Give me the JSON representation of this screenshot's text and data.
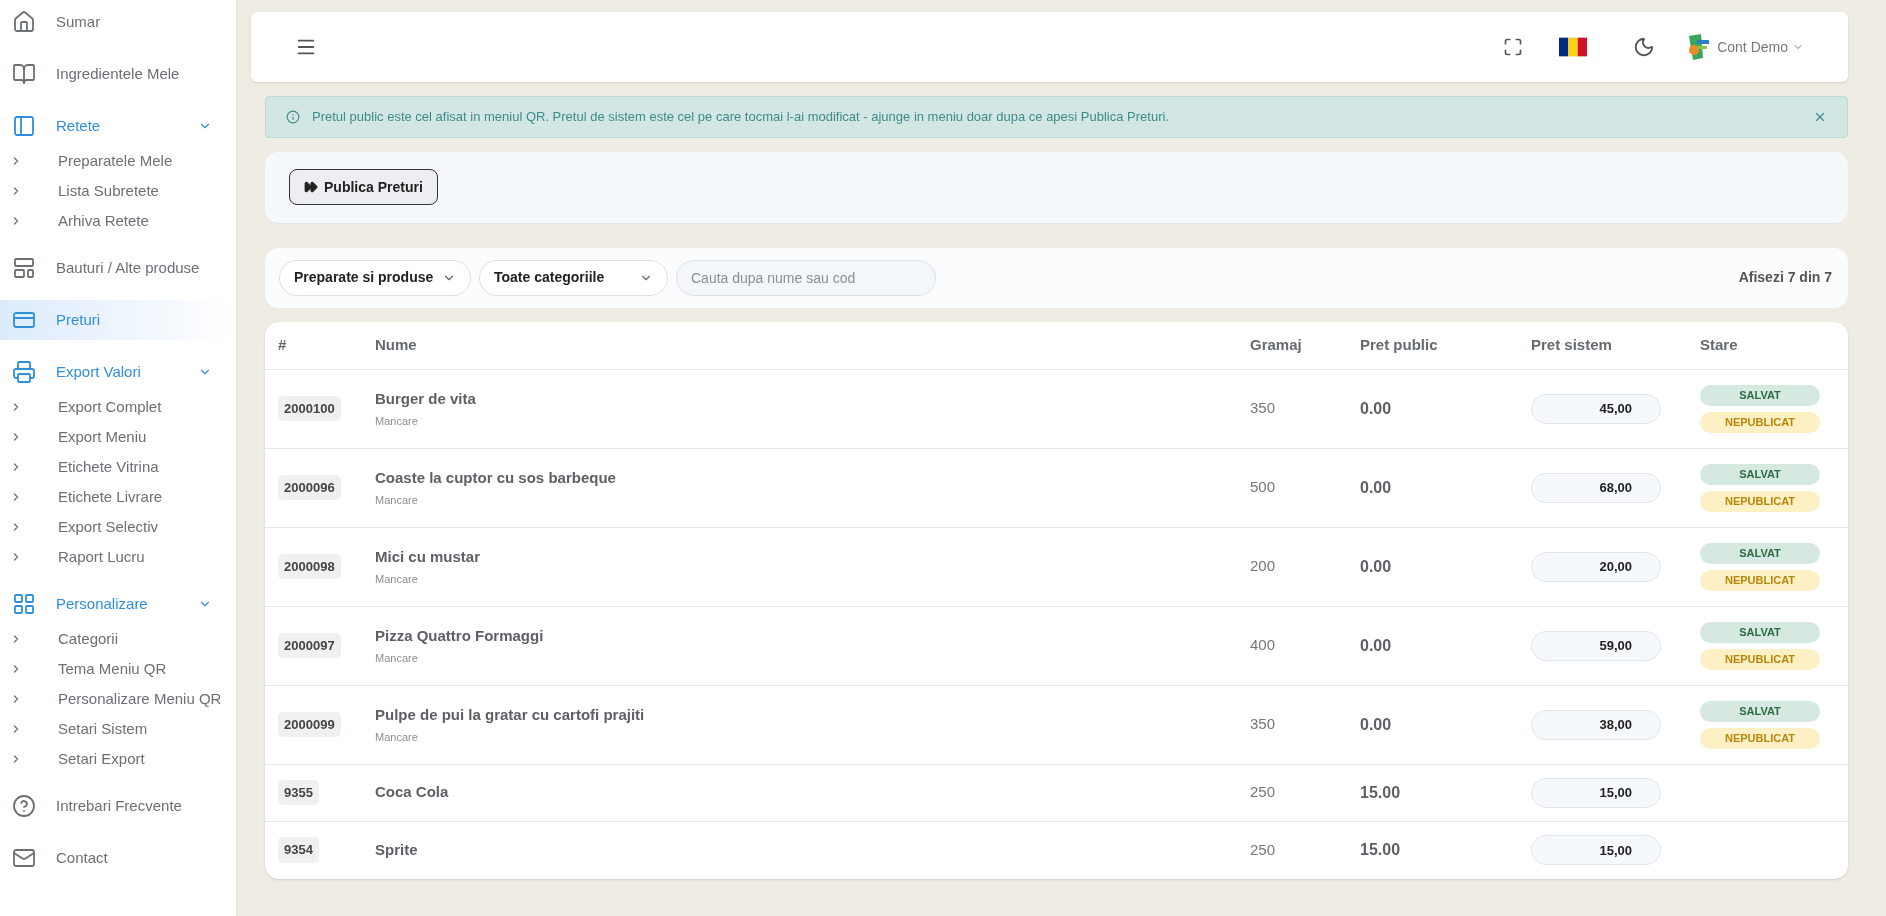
{
  "sidebar": {
    "items": [
      {
        "label": "Sumar",
        "selected": false
      },
      {
        "label": "Ingredientele Mele",
        "selected": false
      },
      {
        "label": "Retete",
        "selected": false,
        "expanded": true,
        "children": [
          {
            "label": "Preparatele Mele"
          },
          {
            "label": "Lista Subretete"
          },
          {
            "label": "Arhiva Retete"
          }
        ]
      },
      {
        "label": "Bauturi / Alte produse",
        "selected": false
      },
      {
        "label": "Preturi",
        "selected": true
      },
      {
        "label": "Export Valori",
        "selected": false,
        "expanded": true,
        "children": [
          {
            "label": "Export Complet"
          },
          {
            "label": "Export Meniu"
          },
          {
            "label": "Etichete Vitrina"
          },
          {
            "label": "Etichete Livrare"
          },
          {
            "label": "Export Selectiv"
          },
          {
            "label": "Raport Lucru"
          }
        ]
      },
      {
        "label": "Personalizare",
        "selected": false,
        "expanded": true,
        "children": [
          {
            "label": "Categorii"
          },
          {
            "label": "Tema Meniu QR"
          },
          {
            "label": "Personalizare Meniu QR"
          },
          {
            "label": "Setari Sistem"
          },
          {
            "label": "Setari Export"
          }
        ]
      },
      {
        "label": "Intrebari Frecvente",
        "selected": false
      },
      {
        "label": "Contact",
        "selected": false
      }
    ]
  },
  "header": {
    "account": "Cont Demo"
  },
  "alert": {
    "text": "Pretul public este cel afisat in meniul QR. Pretul de sistem este cel pe care tocmai l-ai modificat - ajunge in meniu doar dupa ce apesi Publica Preturi."
  },
  "publish_button": "Publica Preturi",
  "filters": {
    "type_select": "Preparate si produse",
    "category_select": "Toate categoriile",
    "search": {
      "placeholder": "Cauta dupa nume sau cod"
    },
    "count": "Afisezi 7 din 7"
  },
  "table": {
    "columns": [
      "#",
      "Nume",
      "Gramaj",
      "Pret public",
      "Pret sistem",
      "Stare"
    ],
    "rows": [
      {
        "code": "2000100",
        "name": "Burger de vita",
        "category": "Mancare",
        "weight": "350",
        "public_price": "0.00",
        "system_price": "45,00",
        "statuses": [
          {
            "label": "SALVAT",
            "kind": "saved"
          },
          {
            "label": "NEPUBLICAT",
            "kind": "unpublished"
          }
        ]
      },
      {
        "code": "2000096",
        "name": "Coaste la cuptor cu sos barbeque",
        "category": "Mancare",
        "weight": "500",
        "public_price": "0.00",
        "system_price": "68,00",
        "statuses": [
          {
            "label": "SALVAT",
            "kind": "saved"
          },
          {
            "label": "NEPUBLICAT",
            "kind": "unpublished"
          }
        ]
      },
      {
        "code": "2000098",
        "name": "Mici cu mustar",
        "category": "Mancare",
        "weight": "200",
        "public_price": "0.00",
        "system_price": "20,00",
        "statuses": [
          {
            "label": "SALVAT",
            "kind": "saved"
          },
          {
            "label": "NEPUBLICAT",
            "kind": "unpublished"
          }
        ]
      },
      {
        "code": "2000097",
        "name": "Pizza Quattro Formaggi",
        "category": "Mancare",
        "weight": "400",
        "public_price": "0.00",
        "system_price": "59,00",
        "statuses": [
          {
            "label": "SALVAT",
            "kind": "saved"
          },
          {
            "label": "NEPUBLICAT",
            "kind": "unpublished"
          }
        ]
      },
      {
        "code": "2000099",
        "name": "Pulpe de pui la gratar cu cartofi prajiti",
        "category": "Mancare",
        "weight": "350",
        "public_price": "0.00",
        "system_price": "38,00",
        "statuses": [
          {
            "label": "SALVAT",
            "kind": "saved"
          },
          {
            "label": "NEPUBLICAT",
            "kind": "unpublished"
          }
        ]
      },
      {
        "code": "9355",
        "name": "Coca Cola",
        "weight": "250",
        "public_price": "15.00",
        "system_price": "15,00"
      },
      {
        "code": "9354",
        "name": "Sprite",
        "weight": "250",
        "public_price": "15.00",
        "system_price": "15,00"
      }
    ]
  }
}
